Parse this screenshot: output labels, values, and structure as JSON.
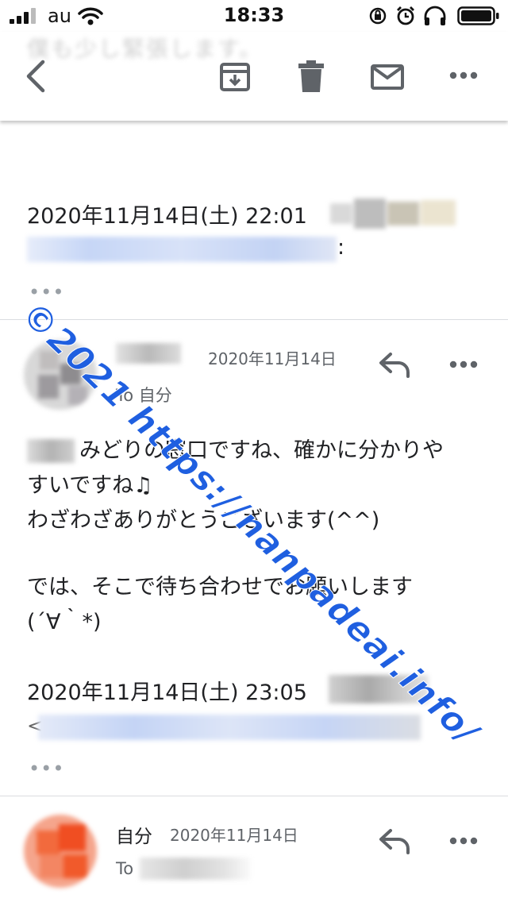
{
  "status_bar": {
    "carrier": "au",
    "time": "18:33"
  },
  "toolbar": {
    "back_icon": "chevron-left-icon",
    "archive_icon": "archive-icon",
    "delete_icon": "trash-icon",
    "mark_unread_icon": "envelope-icon",
    "more_icon": "more-horizontal-icon",
    "ghost_subject": "僕も少し緊張します。"
  },
  "quoted_1": {
    "date": "2020年11月14日(土) 22:01",
    "colon": ":",
    "ellipsis": "•••"
  },
  "message_1": {
    "date": "2020年11月14日",
    "to_label": "To 自分",
    "body_line_1": "みどりの窓口ですね、確かに分かりや",
    "body_line_2": "すいですね♫",
    "body_line_3": "わざわざありがとうございます(^^)",
    "body_line_4": "では、そこで待ち合わせでお願いします",
    "body_line_5": "(´∀｀*)",
    "reply_icon": "reply-icon",
    "more_icon": "more-horizontal-icon"
  },
  "quoted_2": {
    "date": "2020年11月14日(土) 23:05",
    "lead": "<",
    "ellipsis": "•••"
  },
  "message_2": {
    "sender": "自分",
    "date": "2020年11月14日",
    "to_label": "To",
    "reply_icon": "reply-icon",
    "more_icon": "more-horizontal-icon"
  },
  "watermark": "©2021 https://nanpadeai.info/",
  "colors": {
    "watermark": "#1f5fe0",
    "link_blur": "#c8d8f8",
    "avatar_orange": "#f26a3d"
  }
}
